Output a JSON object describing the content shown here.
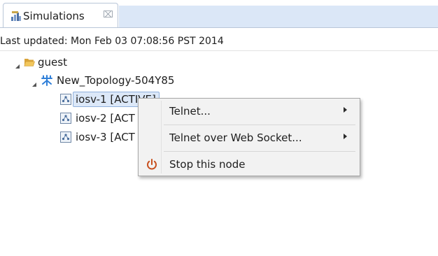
{
  "tab": {
    "label": "Simulations",
    "close_glyph": "⌧",
    "icon": "simulations-icon"
  },
  "status": {
    "last_updated": "Last updated: Mon Feb 03 07:08:56 PST 2014"
  },
  "tree": {
    "root": {
      "label": "guest",
      "icon": "folder-open-icon",
      "expanded": true
    },
    "topology": {
      "label": "New_Topology-504Y85",
      "icon": "topology-icon",
      "expanded": true
    },
    "nodes": [
      {
        "label": "iosv-1 [ACTIVE]",
        "visible": "iosv-1 [ACTIVE]",
        "selected": true,
        "icon": "router-node-icon"
      },
      {
        "label": "iosv-2 [ACT",
        "visible": "iosv-2 [ACT",
        "selected": false,
        "icon": "router-node-icon"
      },
      {
        "label": "iosv-3 [ACT",
        "visible": "iosv-3 [ACT",
        "selected": false,
        "icon": "router-node-icon"
      }
    ]
  },
  "context_menu": {
    "items": [
      {
        "label": "Telnet...",
        "submenu": true
      },
      {
        "label": "Telnet over Web Socket...",
        "submenu": true
      },
      {
        "label": "Stop this node",
        "submenu": false,
        "icon": "power-icon",
        "icon_color": "#c8501e"
      }
    ]
  },
  "colors": {
    "selection_bg": "#dce8f8",
    "selection_border": "#8fb0dc",
    "tabstrip_bg": "#dbe7f7",
    "menu_bg": "#f2f2f2",
    "folder": "#e8b84a",
    "topology": "#2f7fd8"
  }
}
